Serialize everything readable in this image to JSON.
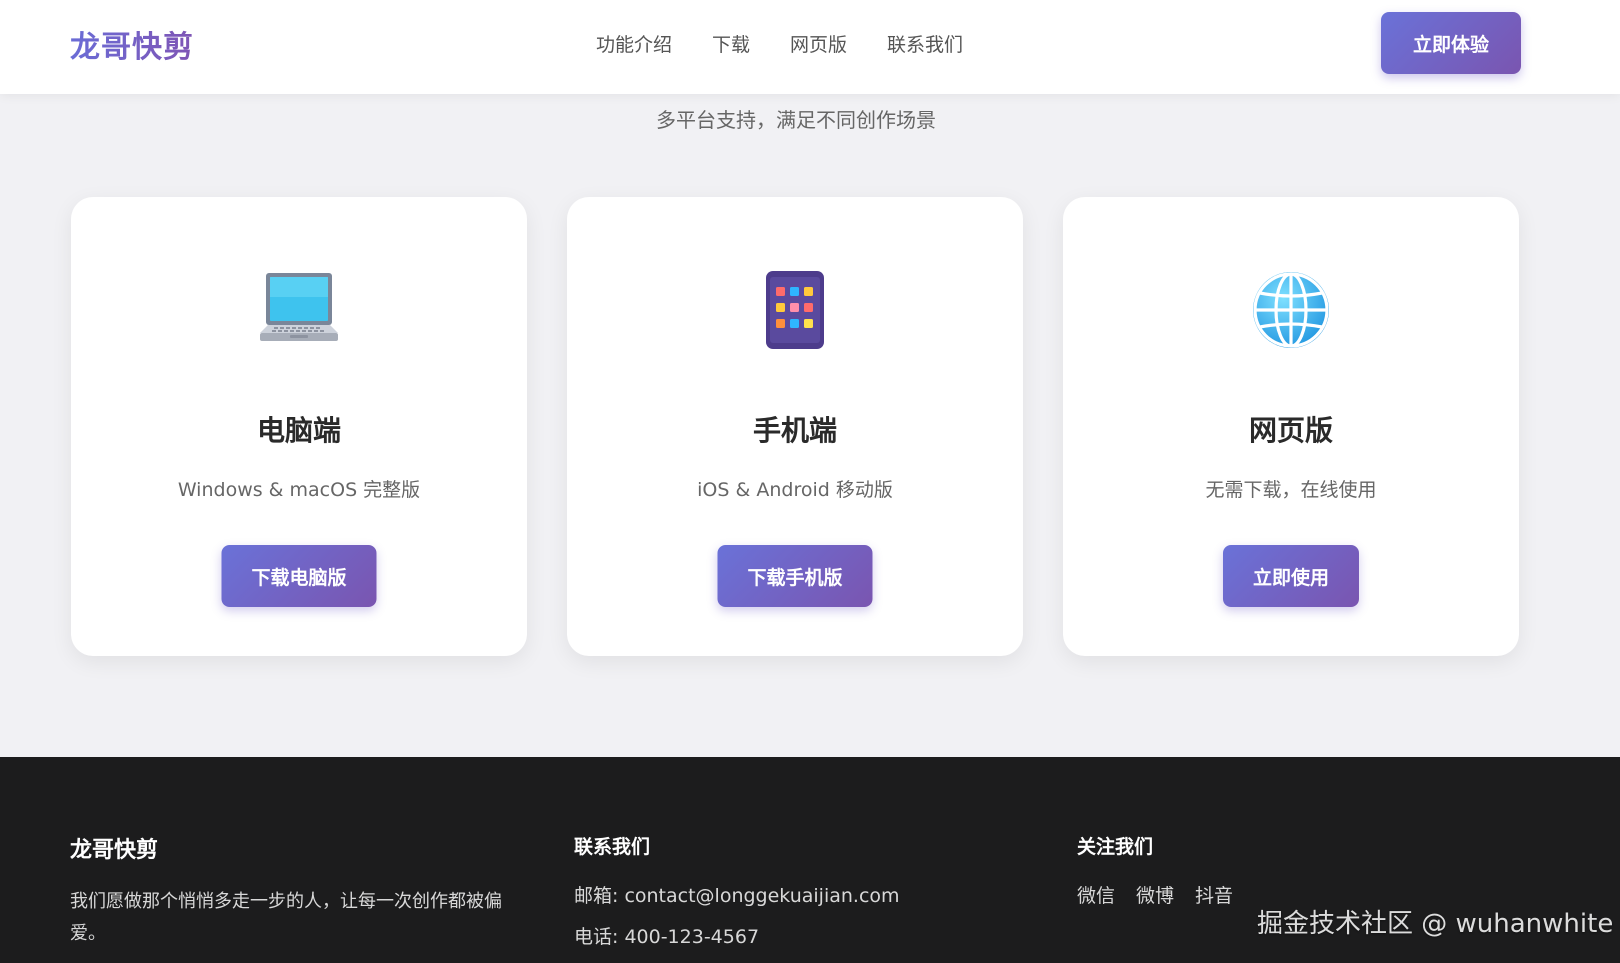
{
  "header": {
    "logo": "龙哥快剪",
    "nav": [
      {
        "label": "功能介绍"
      },
      {
        "label": "下载"
      },
      {
        "label": "网页版"
      },
      {
        "label": "联系我们"
      }
    ],
    "cta_label": "立即体验"
  },
  "platforms": {
    "subtitle": "多平台支持，满足不同创作场景",
    "cards": [
      {
        "icon": "laptop-icon",
        "title": "电脑端",
        "desc": "Windows & macOS 完整版",
        "button": "下载电脑版"
      },
      {
        "icon": "mobile-app-icon",
        "title": "手机端",
        "desc": "iOS & Android 移动版",
        "button": "下载手机版"
      },
      {
        "icon": "globe-icon",
        "title": "网页版",
        "desc": "无需下载，在线使用",
        "button": "立即使用"
      }
    ]
  },
  "footer": {
    "brand": {
      "title": "龙哥快剪",
      "slogan": "我们愿做那个悄悄多走一步的人，让每一次创作都被偏爱。"
    },
    "contact": {
      "title": "联系我们",
      "email": "邮箱: contact@longgekuaijian.com",
      "phone": "电话: 400-123-4567"
    },
    "follow": {
      "title": "关注我们",
      "links": [
        {
          "label": "微信"
        },
        {
          "label": "微博"
        },
        {
          "label": "抖音"
        }
      ]
    }
  },
  "watermark": "掘金技术社区 @ wuhanwhite",
  "colors": {
    "accent_start": "#6a72d8",
    "accent_end": "#7a55b0",
    "footer_bg": "#1c1c1d",
    "page_bg": "#f1f1f4"
  }
}
